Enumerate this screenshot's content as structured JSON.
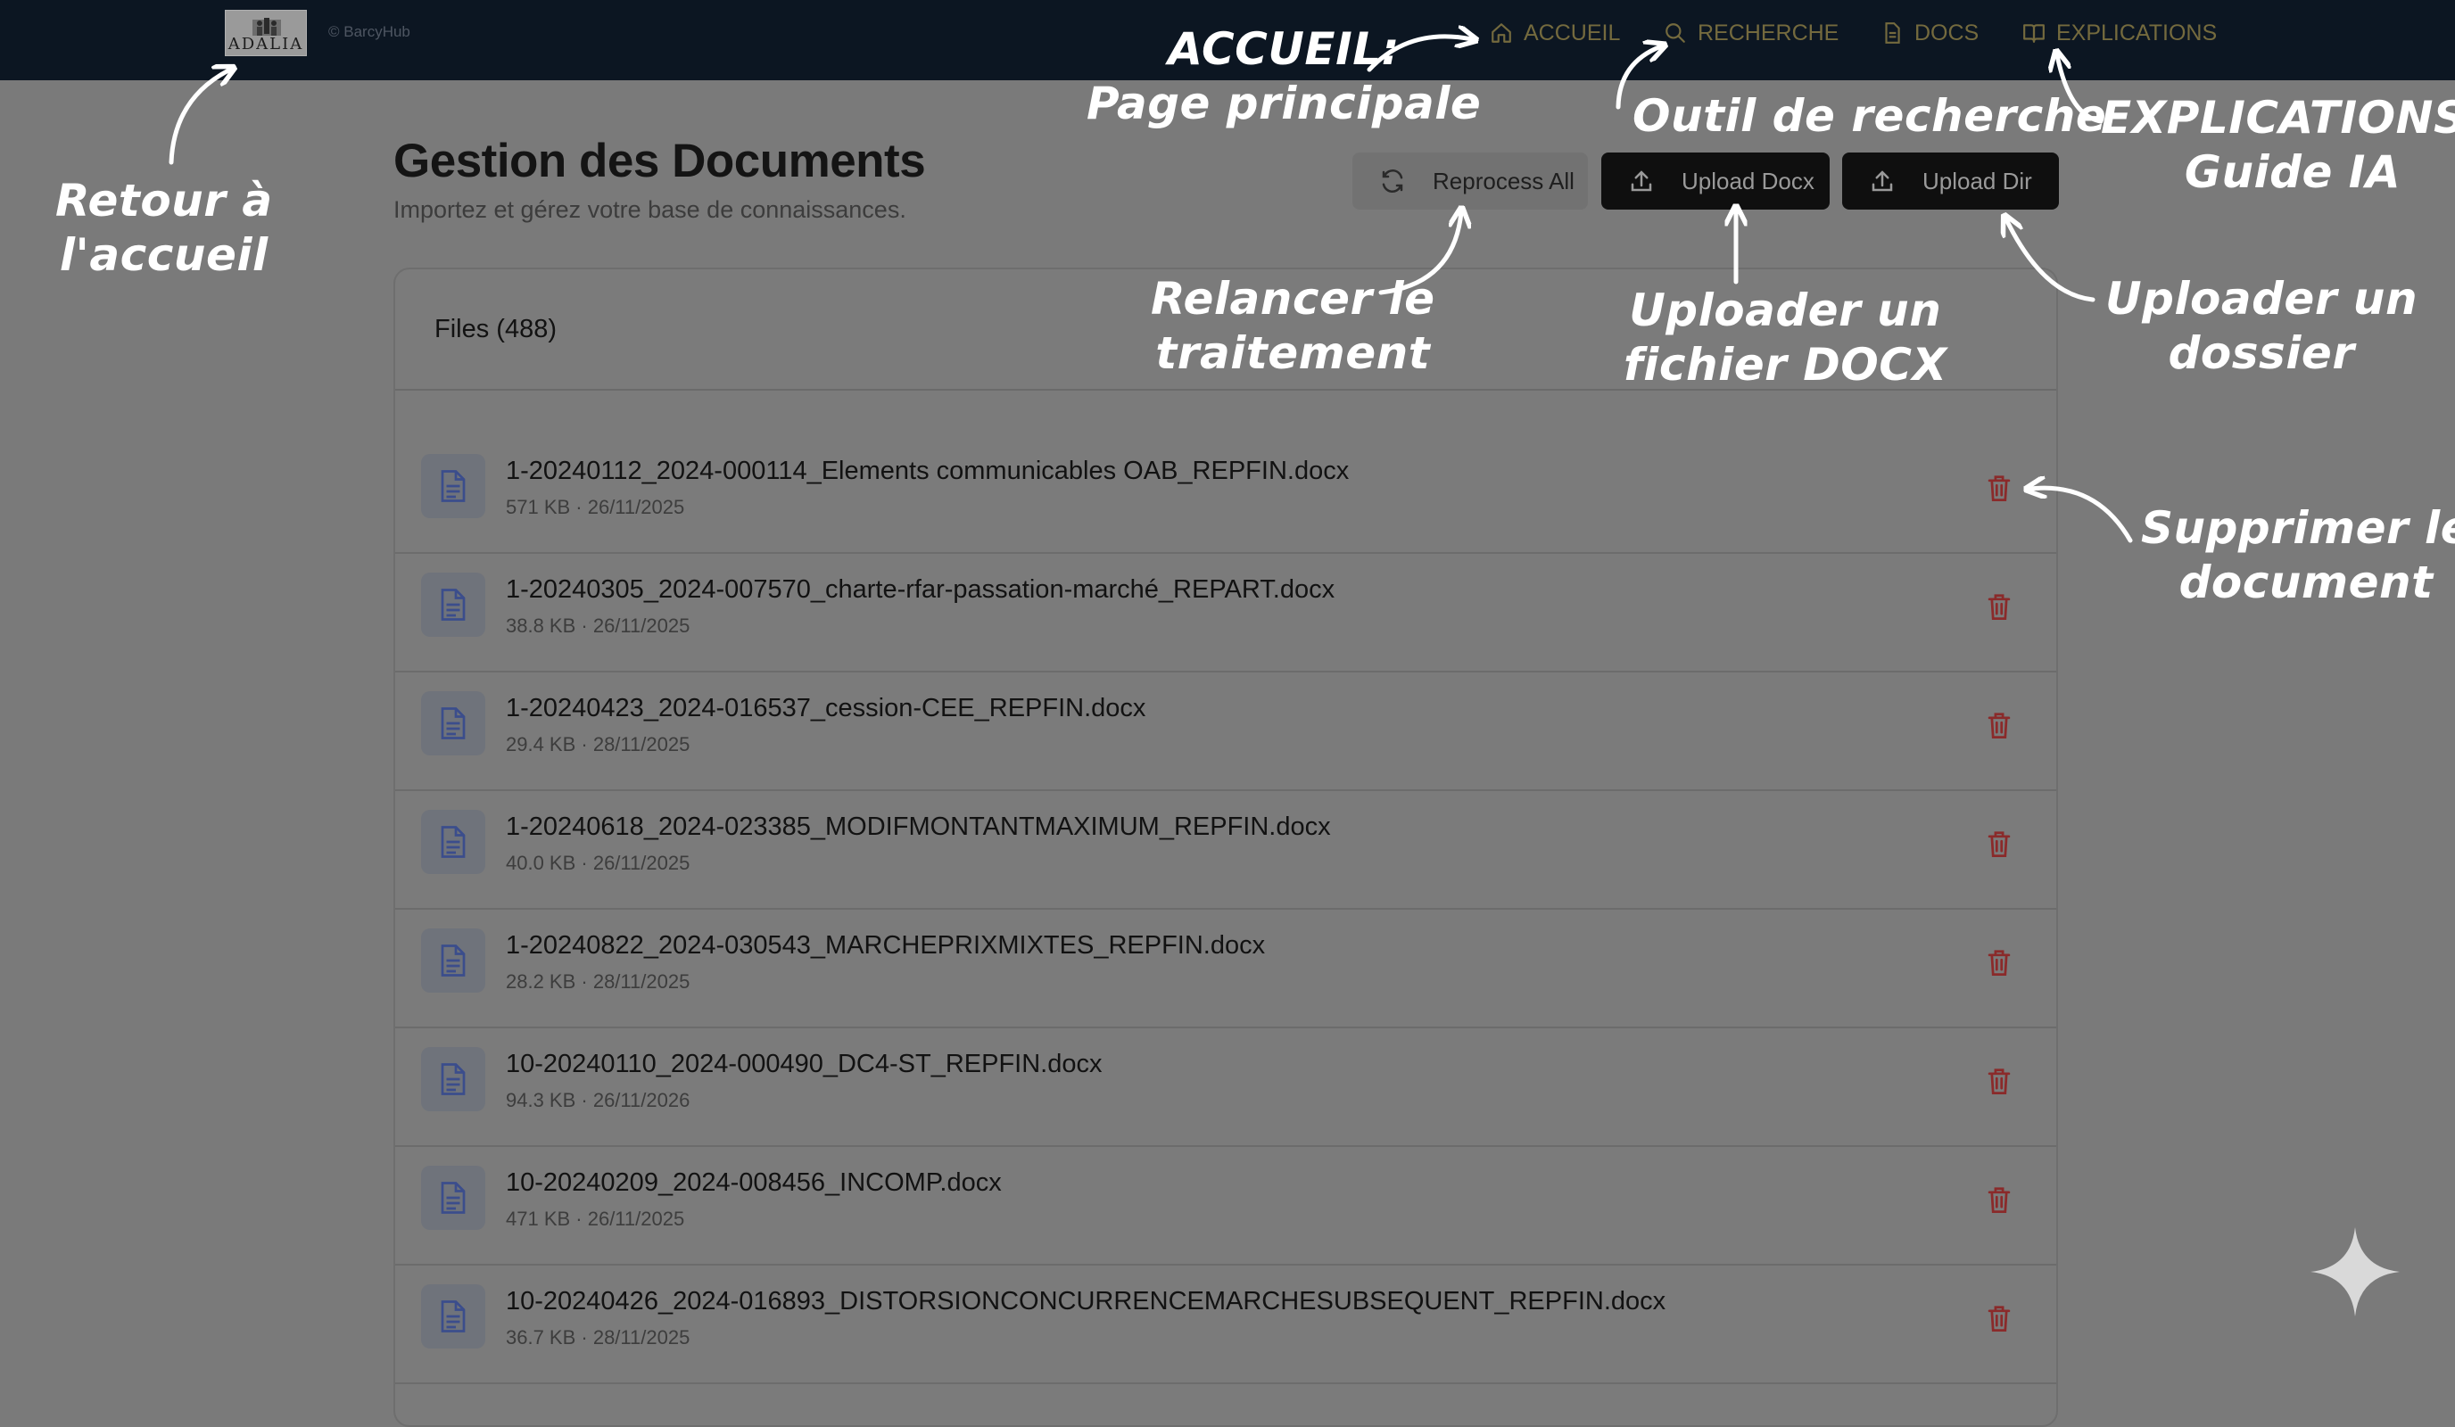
{
  "navbar": {
    "logo_text": "ADALIA",
    "copyright": "© BarcyHub",
    "links": [
      {
        "label": "ACCUEIL",
        "icon": "home-icon"
      },
      {
        "label": "RECHERCHE",
        "icon": "search-icon"
      },
      {
        "label": "DOCS",
        "icon": "document-icon"
      },
      {
        "label": "EXPLICATIONS",
        "icon": "book-icon"
      }
    ]
  },
  "page": {
    "title": "Gestion des Documents",
    "subtitle": "Importez et gérez votre base de connaissances."
  },
  "actions": {
    "reprocess_label": "Reprocess All",
    "upload_docx_label": "Upload Docx",
    "upload_dir_label": "Upload Dir"
  },
  "files": {
    "header": "Files (488)",
    "items": [
      {
        "name": "1-20240112_2024-000114_Elements communicables OAB_REPFIN.docx",
        "meta": "571 KB · 26/11/2025"
      },
      {
        "name": "1-20240305_2024-007570_charte-rfar-passation-marché_REPART.docx",
        "meta": "38.8 KB · 26/11/2025"
      },
      {
        "name": "1-20240423_2024-016537_cession-CEE_REPFIN.docx",
        "meta": "29.4 KB · 28/11/2025"
      },
      {
        "name": "1-20240618_2024-023385_MODIFMONTANTMAXIMUM_REPFIN.docx",
        "meta": "40.0 KB · 26/11/2025"
      },
      {
        "name": "1-20240822_2024-030543_MARCHEPRIXMIXTES_REPFIN.docx",
        "meta": "28.2 KB · 28/11/2025"
      },
      {
        "name": "10-20240110_2024-000490_DC4-ST_REPFIN.docx",
        "meta": "94.3 KB · 26/11/2026"
      },
      {
        "name": "10-20240209_2024-008456_INCOMP.docx",
        "meta": "471 KB · 26/11/2025"
      },
      {
        "name": "10-20240426_2024-016893_DISTORSIONCONCURRENCEMARCHESUBSEQUENT_REPFIN.docx",
        "meta": "36.7 KB · 28/11/2025"
      }
    ]
  },
  "annotations": {
    "home_return": [
      "Retour à",
      "l'accueil"
    ],
    "accueil": [
      "ACCUEIL:",
      "Page principale"
    ],
    "search_tool": "Outil de recherche",
    "explications": [
      "EXPLICATIONS:",
      "Guide IA"
    ],
    "reprocess": [
      "Relancer le",
      "traitement"
    ],
    "upload_docx": [
      "Uploader un",
      "fichier DOCX"
    ],
    "upload_dir": [
      "Uploader un",
      "dossier"
    ],
    "delete": [
      "Supprimer le",
      "document"
    ]
  },
  "colors": {
    "navbar_bg": "#0c1622",
    "nav_link": "#746a3e",
    "dimmed_page_bg": "#7a7a7a",
    "delete_icon": "#8a2a2a",
    "file_icon": "#3b4d8c",
    "annotation": "#ffffff"
  }
}
